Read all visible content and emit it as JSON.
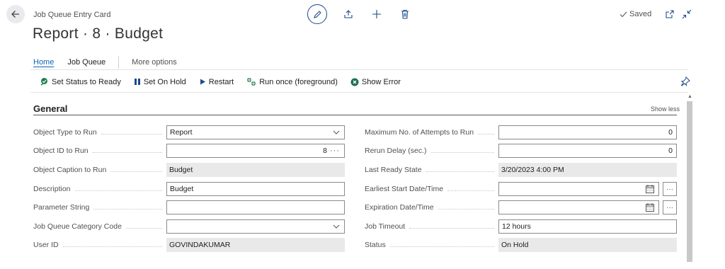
{
  "header": {
    "caption": "Job Queue Entry Card",
    "title": "Report · 8 · Budget",
    "saved_label": "Saved",
    "icons": [
      "back-arrow-icon",
      "pencil-icon",
      "share-icon",
      "plus-icon",
      "trash-icon",
      "check-icon",
      "open-new-window-icon",
      "collapse-icon"
    ]
  },
  "tabs": [
    {
      "label": "Home",
      "active": true
    },
    {
      "label": "Job Queue",
      "active": false
    },
    {
      "label": "More options",
      "active": false
    }
  ],
  "actions": [
    {
      "label": "Set Status to Ready",
      "icon": "status-ready-icon"
    },
    {
      "label": "Set On Hold",
      "icon": "pause-icon"
    },
    {
      "label": "Restart",
      "icon": "play-icon"
    },
    {
      "label": "Run once (foreground)",
      "icon": "run-once-icon"
    },
    {
      "label": "Show Error",
      "icon": "error-icon"
    }
  ],
  "section": {
    "title": "General",
    "toggle_label": "Show less"
  },
  "left_fields": [
    {
      "label": "Object Type to Run",
      "value": "Report",
      "kind": "select"
    },
    {
      "label": "Object ID to Run",
      "value": "8",
      "kind": "lookup"
    },
    {
      "label": "Object Caption to Run",
      "value": "Budget",
      "kind": "readonly"
    },
    {
      "label": "Description",
      "value": "Budget",
      "kind": "input"
    },
    {
      "label": "Parameter String",
      "value": "",
      "kind": "input"
    },
    {
      "label": "Job Queue Category Code",
      "value": "",
      "kind": "select"
    },
    {
      "label": "User ID",
      "value": "GOVINDAKUMAR",
      "kind": "readonly"
    }
  ],
  "right_fields": [
    {
      "label": "Maximum No. of Attempts to Run",
      "value": "0",
      "kind": "number"
    },
    {
      "label": "Rerun Delay (sec.)",
      "value": "0",
      "kind": "number"
    },
    {
      "label": "Last Ready State",
      "value": "3/20/2023 4:00 PM",
      "kind": "readonly"
    },
    {
      "label": "Earliest Start Date/Time",
      "value": "",
      "kind": "datetime"
    },
    {
      "label": "Expiration Date/Time",
      "value": "",
      "kind": "datetime"
    },
    {
      "label": "Job Timeout",
      "value": "12 hours",
      "kind": "input"
    },
    {
      "label": "Status",
      "value": "On Hold",
      "kind": "readonly"
    }
  ],
  "colors": {
    "accent": "#0b64b3",
    "dark_accent": "#1b4a8b",
    "readonly_bg": "#e9e9e9",
    "green_icon": "#1f7d4e",
    "navy_icon": "#1b4a8b",
    "error_icon": "#1f6e57"
  }
}
